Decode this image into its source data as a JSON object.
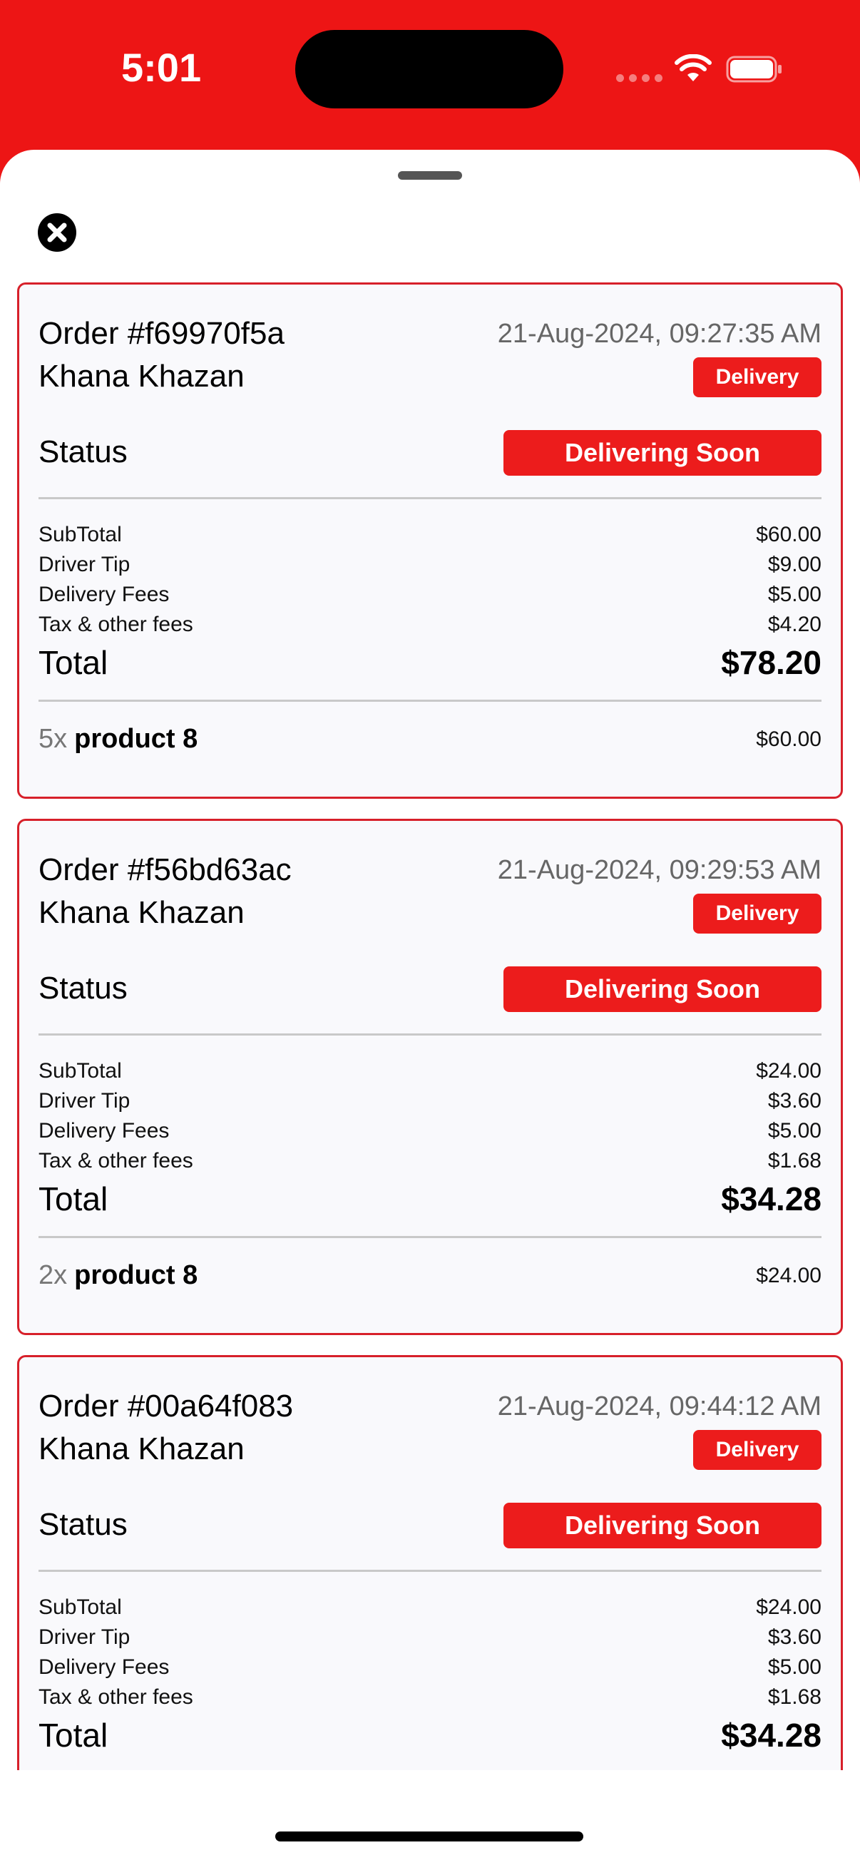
{
  "status_bar": {
    "time": "5:01"
  },
  "colors": {
    "brand": "#ED1515",
    "badge": "#EC1C1C",
    "card_border": "#D7202A",
    "card_bg": "#F9F9FC"
  },
  "close_icon": "close-circle-icon",
  "orders": [
    {
      "order_id": "Order #f69970f5a",
      "restaurant": "Khana Khazan",
      "datetime": "21-Aug-2024, 09:27:35 AM",
      "type": "Delivery",
      "status_label": "Status",
      "status": "Delivering Soon",
      "fees": [
        {
          "label": "SubTotal",
          "value": "$60.00"
        },
        {
          "label": "Driver Tip",
          "value": "$9.00"
        },
        {
          "label": "Delivery Fees",
          "value": "$5.00"
        },
        {
          "label": "Tax & other fees",
          "value": "$4.20"
        }
      ],
      "total_label": "Total",
      "total": "$78.20",
      "items": [
        {
          "qty": "5x",
          "name": "product 8",
          "price": "$60.00"
        }
      ]
    },
    {
      "order_id": "Order #f56bd63ac",
      "restaurant": "Khana Khazan",
      "datetime": "21-Aug-2024, 09:29:53 AM",
      "type": "Delivery",
      "status_label": "Status",
      "status": "Delivering Soon",
      "fees": [
        {
          "label": "SubTotal",
          "value": "$24.00"
        },
        {
          "label": "Driver Tip",
          "value": "$3.60"
        },
        {
          "label": "Delivery Fees",
          "value": "$5.00"
        },
        {
          "label": "Tax & other fees",
          "value": "$1.68"
        }
      ],
      "total_label": "Total",
      "total": "$34.28",
      "items": [
        {
          "qty": "2x",
          "name": "product 8",
          "price": "$24.00"
        }
      ]
    },
    {
      "order_id": "Order #00a64f083",
      "restaurant": "Khana Khazan",
      "datetime": "21-Aug-2024, 09:44:12 AM",
      "type": "Delivery",
      "status_label": "Status",
      "status": "Delivering Soon",
      "fees": [
        {
          "label": "SubTotal",
          "value": "$24.00"
        },
        {
          "label": "Driver Tip",
          "value": "$3.60"
        },
        {
          "label": "Delivery Fees",
          "value": "$5.00"
        },
        {
          "label": "Tax & other fees",
          "value": "$1.68"
        }
      ],
      "total_label": "Total",
      "total": "$34.28",
      "items": []
    }
  ]
}
